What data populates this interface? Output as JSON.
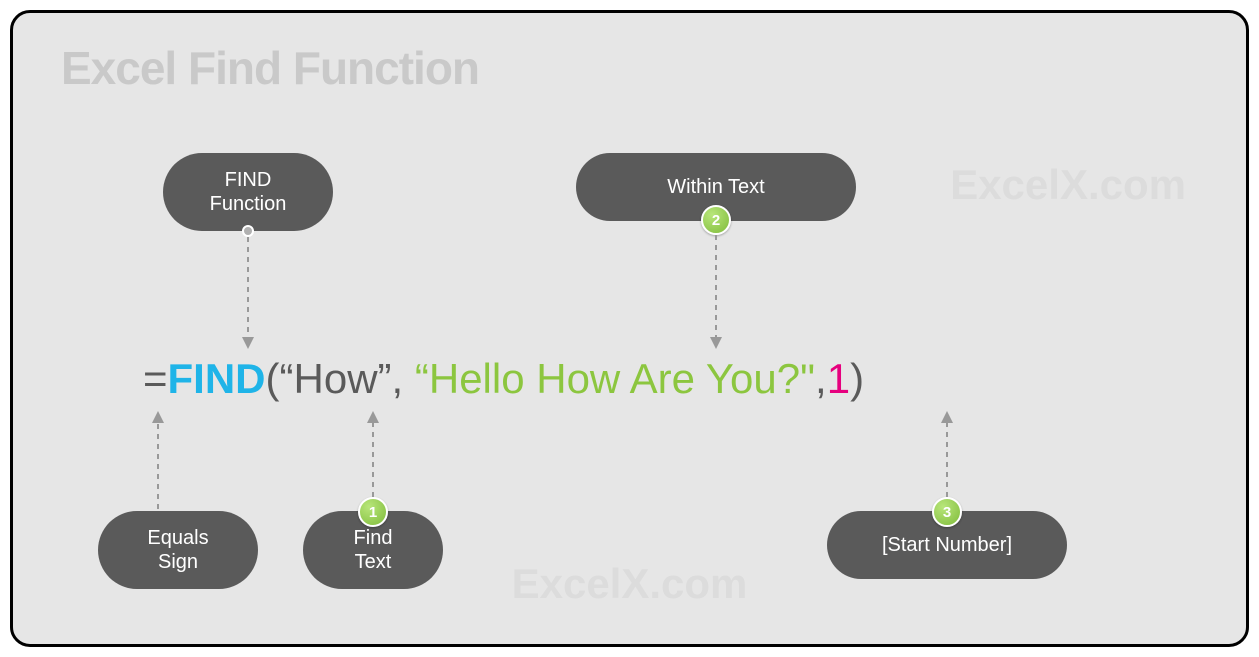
{
  "title": "Excel Find Function",
  "watermark": "ExcelX.com",
  "formula": {
    "equals": "=",
    "func": "FIND",
    "open": "(",
    "arg1": "“How”",
    "comma1": ", ",
    "arg2": "“Hello How Are You?\"",
    "comma2": ",",
    "arg3": "1",
    "close": ")"
  },
  "labels": {
    "find_function": "FIND\nFunction",
    "within_text": "Within Text",
    "equals_sign": "Equals\nSign",
    "find_text": "Find\nText",
    "start_number": "[Start Number]"
  },
  "badges": {
    "b1": "1",
    "b2": "2",
    "b3": "3"
  }
}
